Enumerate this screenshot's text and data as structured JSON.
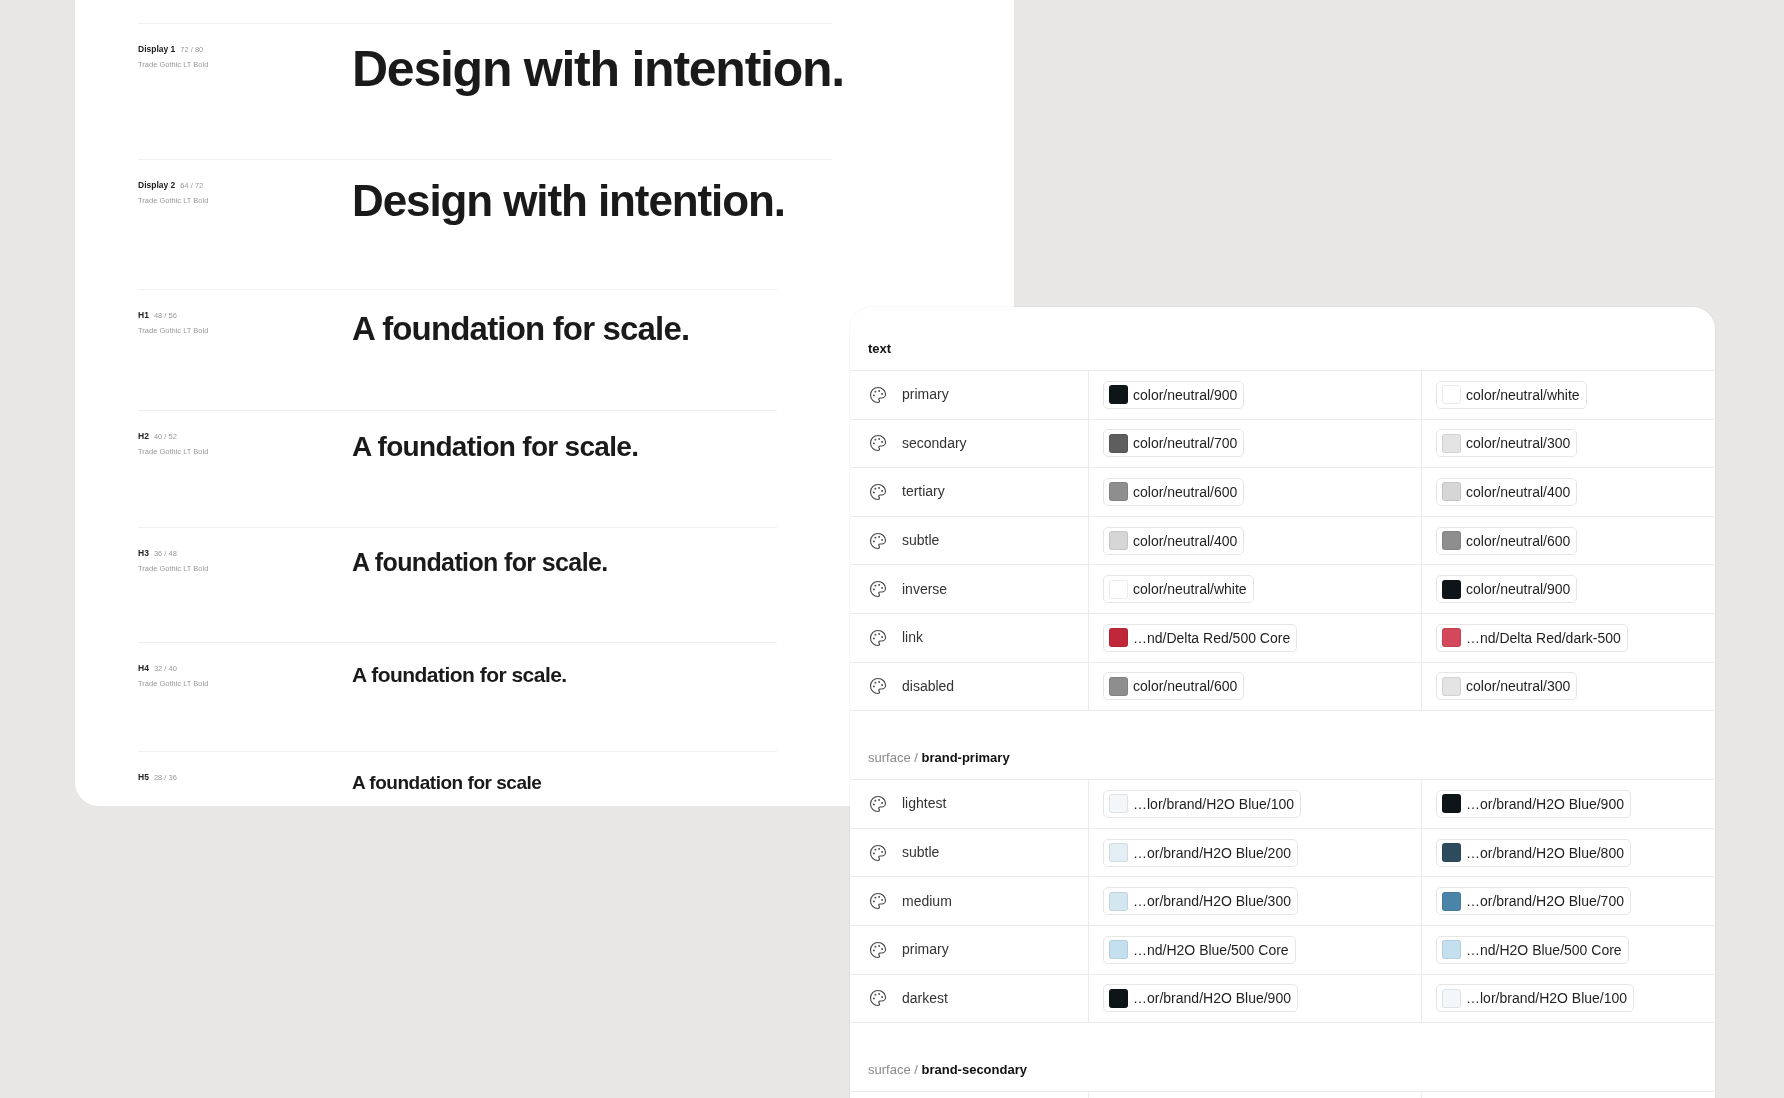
{
  "type_scale": {
    "rows": [
      {
        "name": "Display 1",
        "metrics": "72 / 80",
        "font": "Trade Gothic LT Bold",
        "sample": "Design with intention."
      },
      {
        "name": "Display 2",
        "metrics": "64 / 72",
        "font": "Trade Gothic LT Bold",
        "sample": "Design with intention."
      },
      {
        "name": "H1",
        "metrics": "48 / 56",
        "font": "Trade Gothic LT Bold",
        "sample": "A foundation for scale."
      },
      {
        "name": "H2",
        "metrics": "40 / 52",
        "font": "Trade Gothic LT Bold",
        "sample": "A foundation for scale."
      },
      {
        "name": "H3",
        "metrics": "36 / 48",
        "font": "Trade Gothic LT Bold",
        "sample": "A foundation for scale."
      },
      {
        "name": "H4",
        "metrics": "32 / 40",
        "font": "Trade Gothic LT Bold",
        "sample": "A foundation for scale."
      },
      {
        "name": "H5",
        "metrics": "28 / 36",
        "sample": "A foundation for scale"
      }
    ]
  },
  "token_table": {
    "sections": [
      {
        "title": "text",
        "rows": [
          {
            "name": "primary",
            "values": [
              {
                "token": "color/neutral/900",
                "color": "#0e1519"
              },
              {
                "token": "color/neutral/white",
                "color": "#ffffff"
              }
            ]
          },
          {
            "name": "secondary",
            "values": [
              {
                "token": "color/neutral/700",
                "color": "#5e5e5e"
              },
              {
                "token": "color/neutral/300",
                "color": "#e4e4e4"
              }
            ]
          },
          {
            "name": "tertiary",
            "values": [
              {
                "token": "color/neutral/600",
                "color": "#8e8e8e"
              },
              {
                "token": "color/neutral/400",
                "color": "#d6d6d6"
              }
            ]
          },
          {
            "name": "subtle",
            "values": [
              {
                "token": "color/neutral/400",
                "color": "#d6d6d6"
              },
              {
                "token": "color/neutral/600",
                "color": "#8e8e8e"
              }
            ]
          },
          {
            "name": "inverse",
            "values": [
              {
                "token": "color/neutral/white",
                "color": "#ffffff"
              },
              {
                "token": "color/neutral/900",
                "color": "#0e1519"
              }
            ]
          },
          {
            "name": "link",
            "values": [
              {
                "token": "…nd/Delta Red/500 Core",
                "color": "#c0283a"
              },
              {
                "token": "…nd/Delta Red/dark-500",
                "color": "#d4485c"
              }
            ]
          },
          {
            "name": "disabled",
            "values": [
              {
                "token": "color/neutral/600",
                "color": "#8e8e8e"
              },
              {
                "token": "color/neutral/300",
                "color": "#e4e4e4"
              }
            ]
          }
        ]
      },
      {
        "prefix": "surface /",
        "title": "brand-primary",
        "rows": [
          {
            "name": "lightest",
            "values": [
              {
                "token": "…lor/brand/H2O Blue/100",
                "color": "#f3f7fa"
              },
              {
                "token": "…or/brand/H2O Blue/900",
                "color": "#0e1519"
              }
            ]
          },
          {
            "name": "subtle",
            "values": [
              {
                "token": "…or/brand/H2O Blue/200",
                "color": "#e3eff5"
              },
              {
                "token": "…or/brand/H2O Blue/800",
                "color": "#2e4b5e"
              }
            ]
          },
          {
            "name": "medium",
            "values": [
              {
                "token": "…or/brand/H2O Blue/300",
                "color": "#d3e7f1"
              },
              {
                "token": "…or/brand/H2O Blue/700",
                "color": "#4b84a9"
              }
            ]
          },
          {
            "name": "primary",
            "values": [
              {
                "token": "…nd/H2O Blue/500 Core",
                "color": "#c4e0ee"
              },
              {
                "token": "…nd/H2O Blue/500 Core",
                "color": "#c4e0ee"
              }
            ]
          },
          {
            "name": "darkest",
            "values": [
              {
                "token": "…or/brand/H2O Blue/900",
                "color": "#0e1519"
              },
              {
                "token": "…lor/brand/H2O Blue/100",
                "color": "#f3f7fa"
              }
            ]
          }
        ]
      },
      {
        "prefix": "surface /",
        "title": "brand-secondary"
      }
    ]
  }
}
